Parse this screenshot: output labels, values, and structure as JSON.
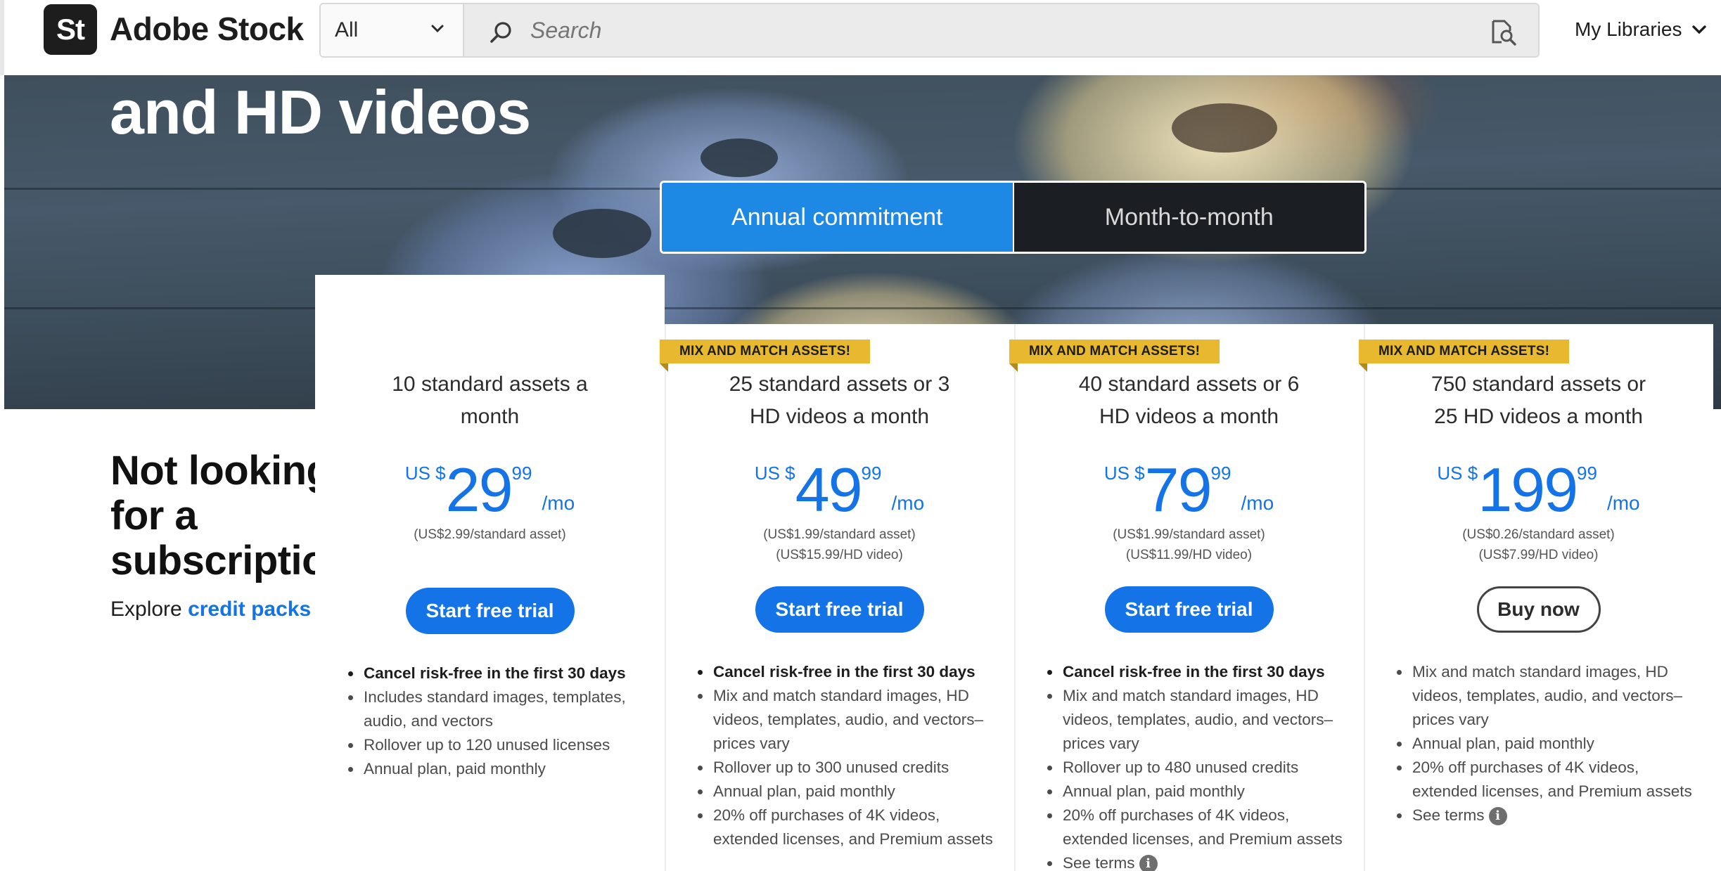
{
  "header": {
    "logo_mark": "St",
    "logo_text": "Adobe Stock",
    "filter_value": "All",
    "search_placeholder": "Search",
    "my_libraries": "My Libraries",
    "icons": [
      "magnifier-icon",
      "visual-search-icon",
      "chevron-down-icon"
    ]
  },
  "hero": {
    "title": "and HD videos",
    "toggle": {
      "annual": "Annual commitment",
      "monthly": "Month-to-month",
      "selected": "annual"
    }
  },
  "promo": {
    "title": "Not looking for a subscription?",
    "sub_prefix": "Explore ",
    "link": "credit packs ›"
  },
  "colors": {
    "accent_blue": "#1473e6",
    "toggle_active": "#1e88e5",
    "badge": "#e8b92e"
  },
  "plans": [
    {
      "badge": "",
      "title": "10 standard assets a month",
      "currency": "US $",
      "price_main": "29",
      "price_cents": "99",
      "per_period": "/mo",
      "unit_prices": [
        "(US$2.99/standard asset)"
      ],
      "button": "Start free trial",
      "button_style": "primary",
      "features": [
        {
          "text": "Cancel risk-free in the first 30 days",
          "bold": true
        },
        {
          "text": "Includes standard images, templates, audio, and vectors",
          "bold": false
        },
        {
          "text": "Rollover up to 120 unused licenses",
          "bold": false
        },
        {
          "text": "Annual plan, paid monthly",
          "bold": false
        }
      ]
    },
    {
      "badge": "MIX AND MATCH ASSETS!",
      "title": "25 standard assets or 3 HD videos a month",
      "currency": "US $",
      "price_main": "49",
      "price_cents": "99",
      "per_period": "/mo",
      "unit_prices": [
        "(US$1.99/standard asset)",
        "(US$15.99/HD video)"
      ],
      "button": "Start free trial",
      "button_style": "primary",
      "features": [
        {
          "text": "Cancel risk-free in the first 30 days",
          "bold": true
        },
        {
          "text": "Mix and match standard images, HD videos, templates, audio, and vectors–prices vary",
          "bold": false
        },
        {
          "text": "Rollover up to 300 unused credits",
          "bold": false
        },
        {
          "text": "Annual plan, paid monthly",
          "bold": false
        },
        {
          "text": "20% off purchases of 4K videos, extended licenses, and Premium assets",
          "bold": false
        }
      ]
    },
    {
      "badge": "MIX AND MATCH ASSETS!",
      "title": "40 standard assets or 6 HD videos a month",
      "currency": "US $",
      "price_main": "79",
      "price_cents": "99",
      "per_period": "/mo",
      "unit_prices": [
        "(US$1.99/standard asset)",
        "(US$11.99/HD video)"
      ],
      "button": "Start free trial",
      "button_style": "primary",
      "features": [
        {
          "text": "Cancel risk-free in the first 30 days",
          "bold": true
        },
        {
          "text": "Mix and match standard images, HD videos, templates, audio, and vectors–prices vary",
          "bold": false
        },
        {
          "text": "Rollover up to 480 unused credits",
          "bold": false
        },
        {
          "text": "Annual plan, paid monthly",
          "bold": false
        },
        {
          "text": "20% off purchases of 4K videos, extended licenses, and Premium assets",
          "bold": false
        },
        {
          "text": "See terms",
          "bold": false,
          "info": true
        }
      ]
    },
    {
      "badge": "MIX AND MATCH ASSETS!",
      "title": "750 standard assets or 25 HD videos a month",
      "currency": "US $",
      "price_main": "199",
      "price_cents": "99",
      "per_period": "/mo",
      "unit_prices": [
        "(US$0.26/standard asset)",
        "(US$7.99/HD video)"
      ],
      "button": "Buy now",
      "button_style": "outline",
      "features": [
        {
          "text": "Mix and match standard images, HD videos, templates, audio, and vectors–prices vary",
          "bold": false
        },
        {
          "text": "Annual plan, paid monthly",
          "bold": false
        },
        {
          "text": "20% off purchases of 4K videos, extended licenses, and Premium assets",
          "bold": false
        },
        {
          "text": "See terms",
          "bold": false,
          "info": true
        }
      ]
    }
  ]
}
